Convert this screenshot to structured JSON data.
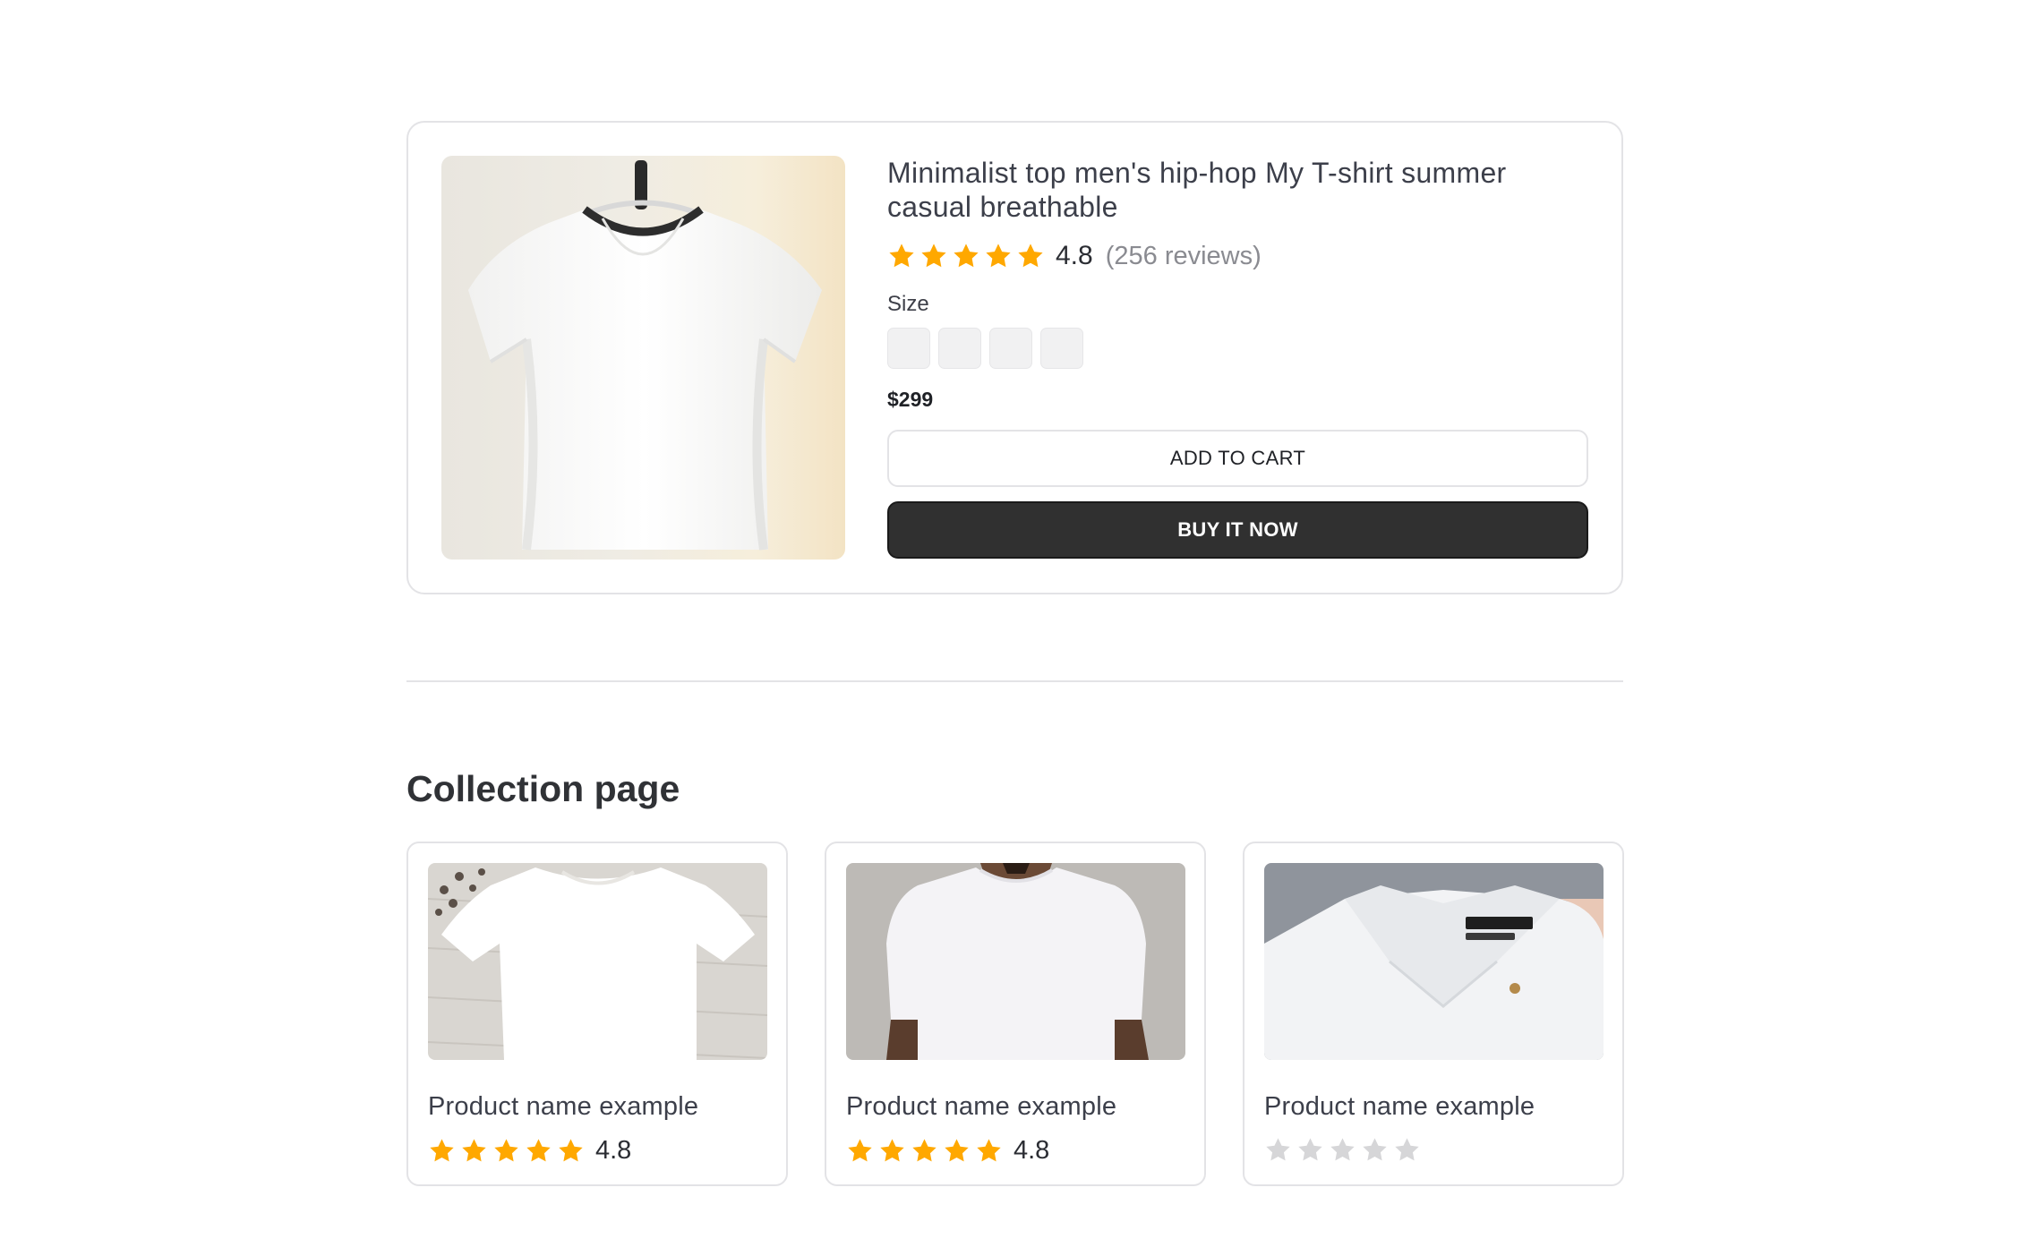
{
  "product": {
    "image_alt": "white-tshirt-on-hanger",
    "title": "Minimalist top men's hip-hop My T-shirt summer casual breathable",
    "rating": 4.8,
    "rating_text": "4.8",
    "reviews_text": "(256 reviews)",
    "size_label": "Size",
    "sizes": [
      "",
      "",
      "",
      ""
    ],
    "price": "$299",
    "add_to_cart_label": "ADD TO CART",
    "buy_now_label": "BUY IT NOW"
  },
  "collection": {
    "title": "Collection page",
    "items": [
      {
        "name": "Product name example",
        "rating": 4.8,
        "rating_text": "4.8",
        "stars_filled": 5,
        "image": "white-tshirt-flatlay"
      },
      {
        "name": "Product name example",
        "rating": 4.8,
        "rating_text": "4.8",
        "stars_filled": 5,
        "image": "man-wearing-white-tshirt"
      },
      {
        "name": "Product name example",
        "rating": null,
        "rating_text": "",
        "stars_filled": 0,
        "image": "white-shirt-collar"
      }
    ]
  },
  "colors": {
    "star_filled": "#FFA800",
    "star_empty": "#D6D6D8",
    "buy_button_bg": "#303030",
    "border": "#E3E3E6"
  },
  "icons": {
    "rating": "star-icon"
  }
}
